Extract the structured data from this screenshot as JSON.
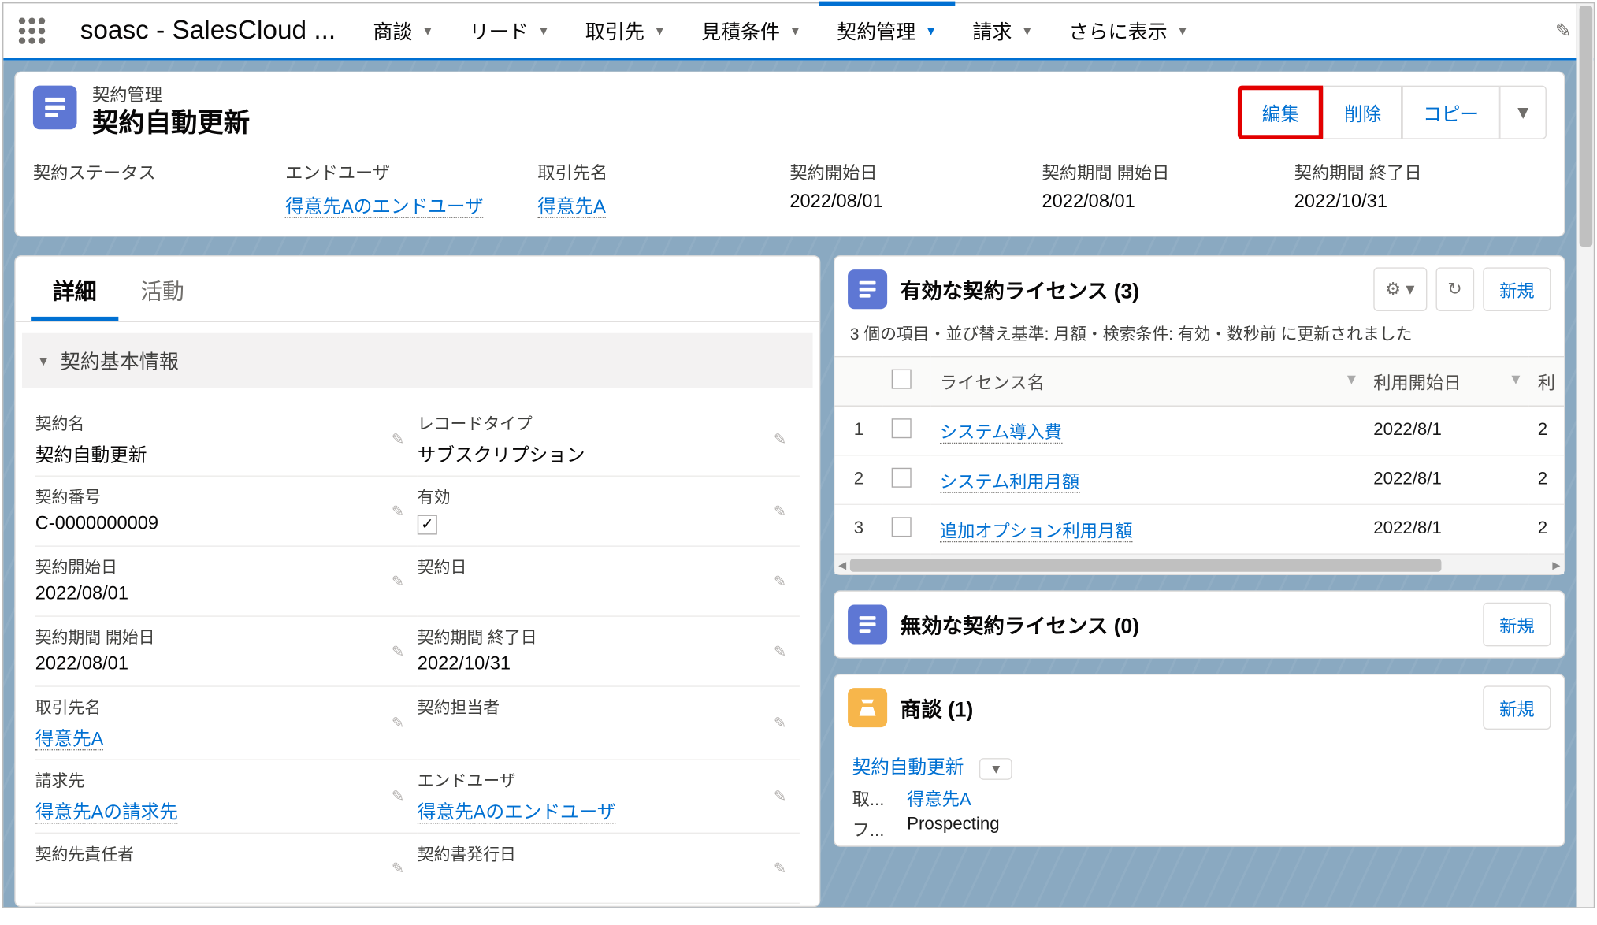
{
  "app_name": "soasc - SalesCloud ...",
  "nav": [
    {
      "label": "商談"
    },
    {
      "label": "リード"
    },
    {
      "label": "取引先"
    },
    {
      "label": "見積条件"
    },
    {
      "label": "契約管理",
      "active": true
    },
    {
      "label": "請求"
    },
    {
      "label": "さらに表示"
    }
  ],
  "highlight": {
    "object_label": "契約管理",
    "record_title": "契約自動更新",
    "actions": {
      "edit": "編集",
      "delete": "削除",
      "copy": "コピー"
    },
    "fields": [
      {
        "label": "契約ステータス",
        "value": "",
        "link": false
      },
      {
        "label": "エンドユーザ",
        "value": "得意先Aのエンドユーザ",
        "link": true
      },
      {
        "label": "取引先名",
        "value": "得意先A",
        "link": true
      },
      {
        "label": "契約開始日",
        "value": "2022/08/01",
        "link": false
      },
      {
        "label": "契約期間 開始日",
        "value": "2022/08/01",
        "link": false
      },
      {
        "label": "契約期間 終了日",
        "value": "2022/10/31",
        "link": false
      }
    ]
  },
  "detail": {
    "tabs": {
      "detail": "詳細",
      "activity": "活動"
    },
    "section": "契約基本情報",
    "rows": [
      [
        {
          "label": "契約名",
          "value": "契約自動更新"
        },
        {
          "label": "レコードタイプ",
          "value": "サブスクリプション"
        }
      ],
      [
        {
          "label": "契約番号",
          "value": "C-0000000009"
        },
        {
          "label": "有効",
          "value": "__check__"
        }
      ],
      [
        {
          "label": "契約開始日",
          "value": "2022/08/01"
        },
        {
          "label": "契約日",
          "value": ""
        }
      ],
      [
        {
          "label": "契約期間 開始日",
          "value": "2022/08/01"
        },
        {
          "label": "契約期間 終了日",
          "value": "2022/10/31"
        }
      ],
      [
        {
          "label": "取引先名",
          "value": "得意先A",
          "link": true
        },
        {
          "label": "契約担当者",
          "value": ""
        }
      ],
      [
        {
          "label": "請求先",
          "value": "得意先Aの請求先",
          "link": true
        },
        {
          "label": "エンドユーザ",
          "value": "得意先Aのエンドユーザ",
          "link": true
        }
      ],
      [
        {
          "label": "契約先責任者",
          "value": ""
        },
        {
          "label": "契約書発行日",
          "value": ""
        }
      ]
    ]
  },
  "related": {
    "licenses": {
      "title": "有効な契約ライセンス (3)",
      "subtitle": "3 個の項目・並び替え基準: 月額・検索条件: 有効・数秒前 に更新されました",
      "new_btn": "新規",
      "cols": {
        "name": "ライセンス名",
        "start": "利用開始日",
        "extra": "利"
      },
      "rows": [
        {
          "n": "1",
          "name": "システム導入費",
          "start": "2022/8/1",
          "extra": "2"
        },
        {
          "n": "2",
          "name": "システム利用月額",
          "start": "2022/8/1",
          "extra": "2"
        },
        {
          "n": "3",
          "name": "追加オプション利用月額",
          "start": "2022/8/1",
          "extra": "2"
        }
      ]
    },
    "disabled_licenses": {
      "title": "無効な契約ライセンス (0)",
      "new_btn": "新規"
    },
    "opps": {
      "title": "商談 (1)",
      "new_btn": "新規",
      "record_name": "契約自動更新",
      "rows": [
        {
          "label": "取...",
          "value": "得意先A",
          "link": true
        },
        {
          "label": "フ...",
          "value": "Prospecting",
          "link": false
        }
      ]
    }
  }
}
